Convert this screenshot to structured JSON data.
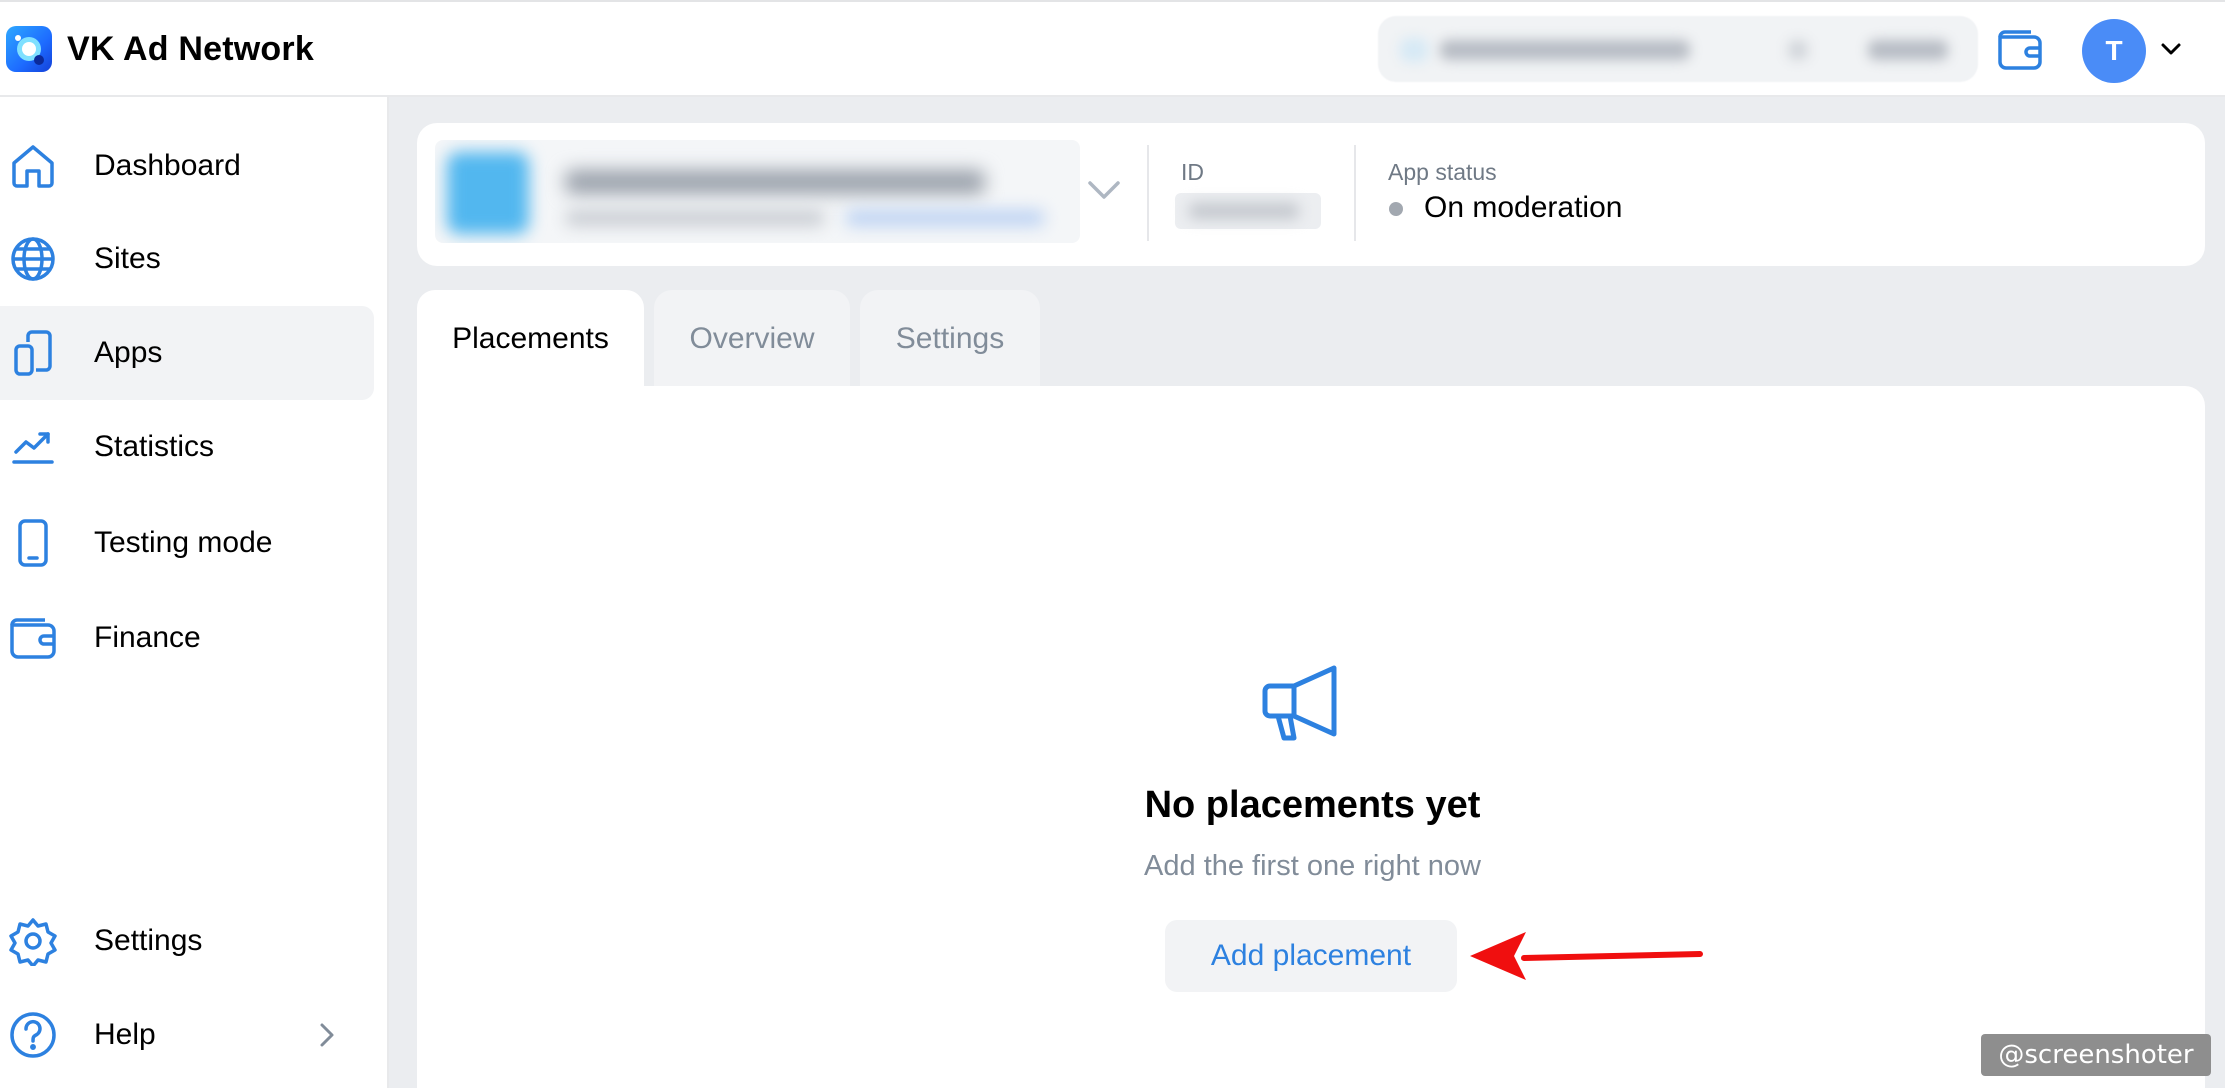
{
  "app": {
    "title": "VK Ad Network",
    "avatar_initial": "T"
  },
  "sidebar": {
    "items": [
      {
        "label": "Dashboard",
        "icon": "home-icon"
      },
      {
        "label": "Sites",
        "icon": "globe-icon"
      },
      {
        "label": "Apps",
        "icon": "apps-icon",
        "active": true
      },
      {
        "label": "Statistics",
        "icon": "chart-icon"
      },
      {
        "label": "Testing mode",
        "icon": "phone-icon"
      },
      {
        "label": "Finance",
        "icon": "wallet-icon"
      },
      {
        "label": "Settings",
        "icon": "gear-icon"
      },
      {
        "label": "Help",
        "icon": "help-icon"
      }
    ]
  },
  "header": {
    "id_label": "ID",
    "status_label": "App status",
    "status_value": "On moderation"
  },
  "tabs": [
    {
      "label": "Placements",
      "active": true
    },
    {
      "label": "Overview"
    },
    {
      "label": "Settings"
    }
  ],
  "empty_state": {
    "title": "No placements yet",
    "subtitle": "Add the first one right now",
    "button": "Add placement"
  },
  "watermark": "@screenshoter",
  "colors": {
    "accent": "#2d81e0",
    "avatar": "#4a8cf7",
    "arrow": "#f00f0f"
  }
}
